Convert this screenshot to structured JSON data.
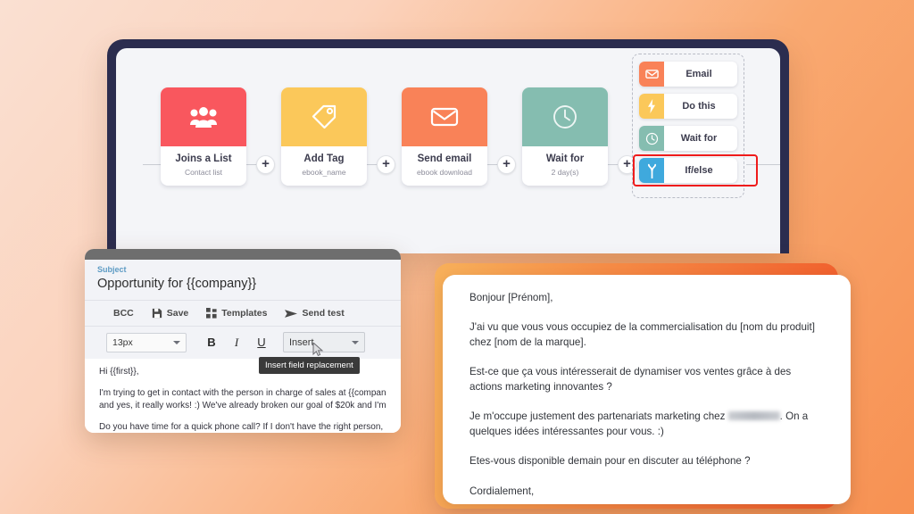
{
  "workflow": {
    "steps": [
      {
        "id": "joins-a-list",
        "title": "Joins a List",
        "sub": "Contact list",
        "color": "#f9575e",
        "icon": "people-icon"
      },
      {
        "id": "add-tag",
        "title": "Add Tag",
        "sub": "ebook_name",
        "color": "#fbc85a",
        "icon": "tag-icon"
      },
      {
        "id": "send-email",
        "title": "Send email",
        "sub": "ebook download",
        "color": "#f98258",
        "icon": "envelope-icon"
      },
      {
        "id": "wait-for",
        "title": "Wait for",
        "sub": "2 day(s)",
        "color": "#85bdb0",
        "icon": "clock-icon"
      }
    ],
    "plus_label": "+",
    "action_menu": {
      "items": [
        {
          "id": "email",
          "label": "Email",
          "icon": "envelope-icon",
          "color": "#f98258"
        },
        {
          "id": "do-this",
          "label": "Do this",
          "icon": "bolt-icon",
          "color": "#fbc85a"
        },
        {
          "id": "wait-for",
          "label": "Wait for",
          "icon": "clock-icon",
          "color": "#85bdb0"
        },
        {
          "id": "if-else",
          "label": "If/else",
          "icon": "branch-icon",
          "color": "#3fa9dd"
        }
      ],
      "highlight_color": "#ef1b1b",
      "highlighted_item": "If/else"
    }
  },
  "email_editor": {
    "subject_label": "Subject",
    "subject_value": "Opportunity for {{company}}",
    "actions": [
      {
        "id": "bcc",
        "label": "BCC",
        "icon": "none"
      },
      {
        "id": "save",
        "label": "Save",
        "icon": "save-icon"
      },
      {
        "id": "templates",
        "label": "Templates",
        "icon": "grid-icon"
      },
      {
        "id": "send-test",
        "label": "Send test",
        "icon": "paper-plane-icon"
      }
    ],
    "font_size": "13px",
    "format_buttons": [
      {
        "id": "bold",
        "label": "B"
      },
      {
        "id": "italic",
        "label": "I"
      },
      {
        "id": "underline",
        "label": "U"
      }
    ],
    "insert_label": "Insert",
    "tooltip": "Insert field replacement",
    "body": [
      "Hi {{first}},",
      "I'm trying to get in contact with the person in charge of sales at {{compan",
      "and yes, it really works! :) We've already broken our goal of $20k and I'm",
      "Do you have time for a quick phone call? If I don't have the right person,"
    ]
  },
  "french_email": {
    "paragraphs": [
      "Bonjour [Prénom],",
      "J'ai vu que vous vous occupiez de la commercialisation du [nom du produit] chez [nom de la marque].",
      "Est-ce que ça vous intéresserait de dynamiser vos ventes grâce à des actions marketing innovantes ?",
      "Etes-vous disponible demain pour en discuter au téléphone ?",
      "Cordialement,"
    ],
    "redacted_paragraph_prefix": "Je m'occupe justement des partenariats marketing chez",
    "redacted_paragraph_suffix": ". On a quelques idées intéressantes pour vous. :)"
  }
}
